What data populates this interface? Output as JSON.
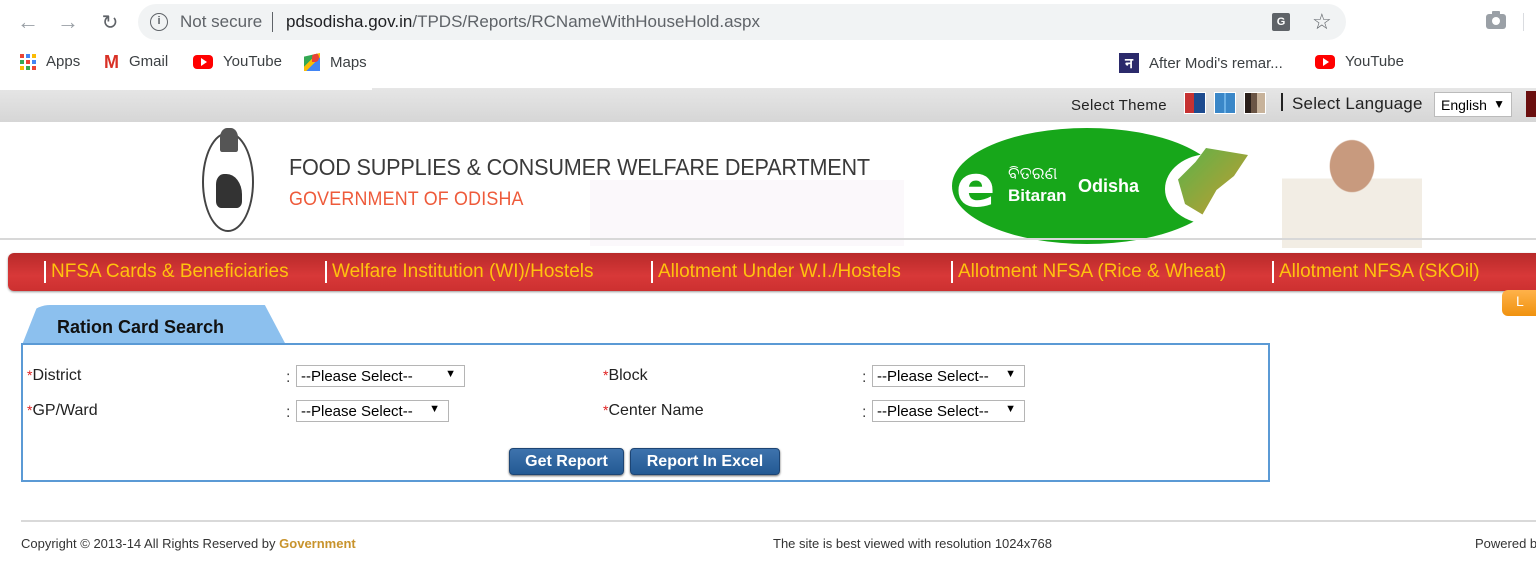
{
  "browser": {
    "back_icon": "←",
    "forward_icon": "→",
    "reload_icon": "↻",
    "info_icon": "i",
    "security_label": "Not secure",
    "url_host": "pdsodisha.gov.in",
    "url_path": "/TPDS/Reports/RCNameWithHouseHold.aspx",
    "translate_icon": "G",
    "star_icon": "☆"
  },
  "bookmarks": [
    {
      "label": "Apps",
      "icon": "apps-grid-icon"
    },
    {
      "label": "Gmail",
      "icon": "gmail-icon"
    },
    {
      "label": "YouTube",
      "icon": "youtube-icon"
    },
    {
      "label": "Maps",
      "icon": "maps-icon"
    },
    {
      "label": "After Modi's remar...",
      "icon": "news-icon"
    },
    {
      "label": "YouTube",
      "icon": "youtube-icon"
    }
  ],
  "topbar": {
    "theme_label": "Select Theme",
    "language_label": "Select Language",
    "language_value": "English",
    "caret": "▼",
    "theme_colors": [
      "#c63232",
      "#3a87c8",
      "#6b5545"
    ]
  },
  "header": {
    "dept_title": "FOOD  SUPPLIES & CONSUMER WELFARE DEPARTMENT",
    "gov_title": "GOVERNMENT OF ODISHA",
    "logo_e": "e",
    "logo_odia": "ବିତରଣ",
    "logo_bitaran": "Bitaran",
    "logo_odisha": "Odisha"
  },
  "menu": {
    "items": [
      "NFSA Cards & Beneficiaries",
      "Welfare Institution (WI)/Hostels",
      "Allotment Under W.I./Hostels",
      "Allotment NFSA (Rice & Wheat)",
      "Allotment NFSA (SKOil)"
    ],
    "side_tab": "L"
  },
  "search": {
    "tab_title": "Ration Card Search",
    "required_mark": "*",
    "colon": ":",
    "fields": [
      {
        "label": "District",
        "value": "--Please Select--"
      },
      {
        "label": "Block",
        "value": "--Please Select--"
      },
      {
        "label": "GP/Ward",
        "value": "--Please Select--"
      },
      {
        "label": "Center Name",
        "value": "--Please Select--"
      }
    ],
    "get_report": "Get Report",
    "report_excel": "Report In Excel"
  },
  "footer": {
    "copyright": "Copyright © 2013-14 All Rights Reserved by ",
    "copyright_link": "Government",
    "resolution_note": "The site is best viewed with resolution 1024x768",
    "powered": "Powered b"
  },
  "colors": {
    "menu_red": "#d83838",
    "menu_text": "#ffc20e",
    "tab_blue": "#8cc0ee",
    "button_blue": "#2d6299",
    "logo_green": "#17a71a",
    "gov_orange": "#ee5a3a"
  }
}
